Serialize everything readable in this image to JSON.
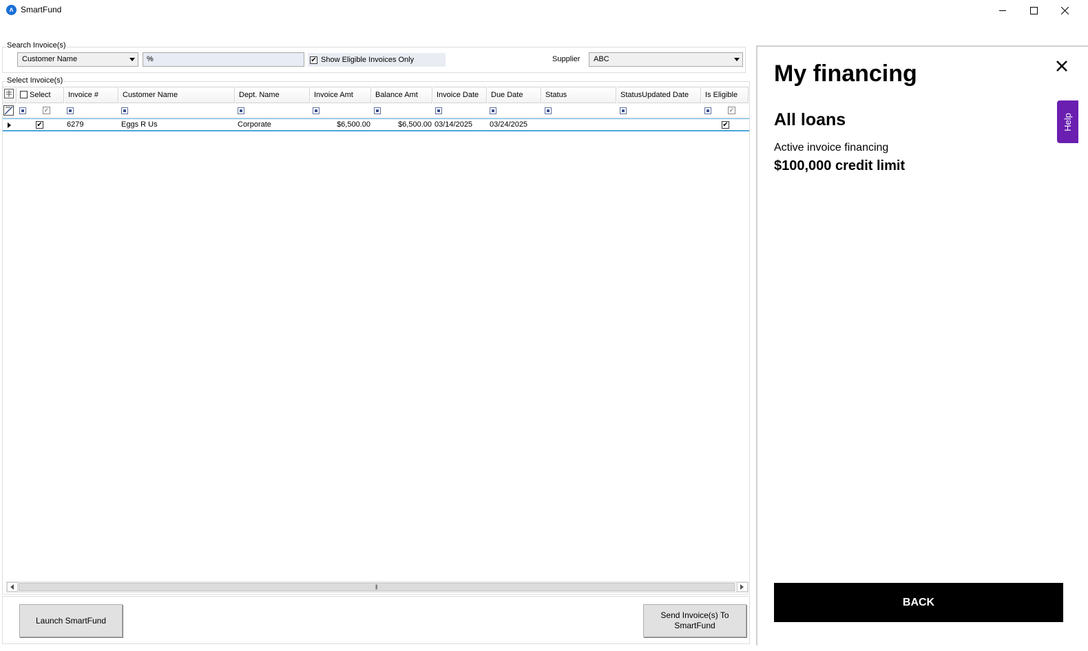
{
  "window": {
    "title": "SmartFund",
    "icon_name": "smartfund-app-icon"
  },
  "search": {
    "group_label": "Search Invoice(s)",
    "field_select": "Customer Name",
    "value": "%",
    "eligible_only_label": "Show Eligible Invoices Only",
    "eligible_only_checked": true,
    "supplier_label": "Supplier",
    "supplier_value": "ABC"
  },
  "grid": {
    "group_label": "Select Invoice(s)",
    "columns": [
      "Select",
      "Invoice #",
      "Customer Name",
      "Dept. Name",
      "Invoice Amt",
      "Balance Amt",
      "Invoice Date",
      "Due Date",
      "Status",
      "StatusUpdated Date",
      "Is Eligible"
    ],
    "rows": [
      {
        "selected": true,
        "invoice_no": "6279",
        "customer_name": "Eggs R Us",
        "dept_name": "Corporate",
        "invoice_amt": "$6,500.00",
        "balance_amt": "$6,500.00",
        "invoice_date": "03/14/2025",
        "due_date": "03/24/2025",
        "status": "",
        "status_updated_date": "",
        "is_eligible": true
      }
    ]
  },
  "buttons": {
    "launch": "Launch SmartFund",
    "send_line1": "Send Invoice(s) To",
    "send_line2": "SmartFund"
  },
  "panel": {
    "title": "My financing",
    "subtitle": "All loans",
    "line1": "Active invoice financing",
    "line2": "$100,000 credit limit",
    "back_label": "BACK",
    "help_label": "Help"
  },
  "colors": {
    "accent": "#4da6d9",
    "help_tab": "#6a1fb0",
    "back_button": "#000000"
  }
}
